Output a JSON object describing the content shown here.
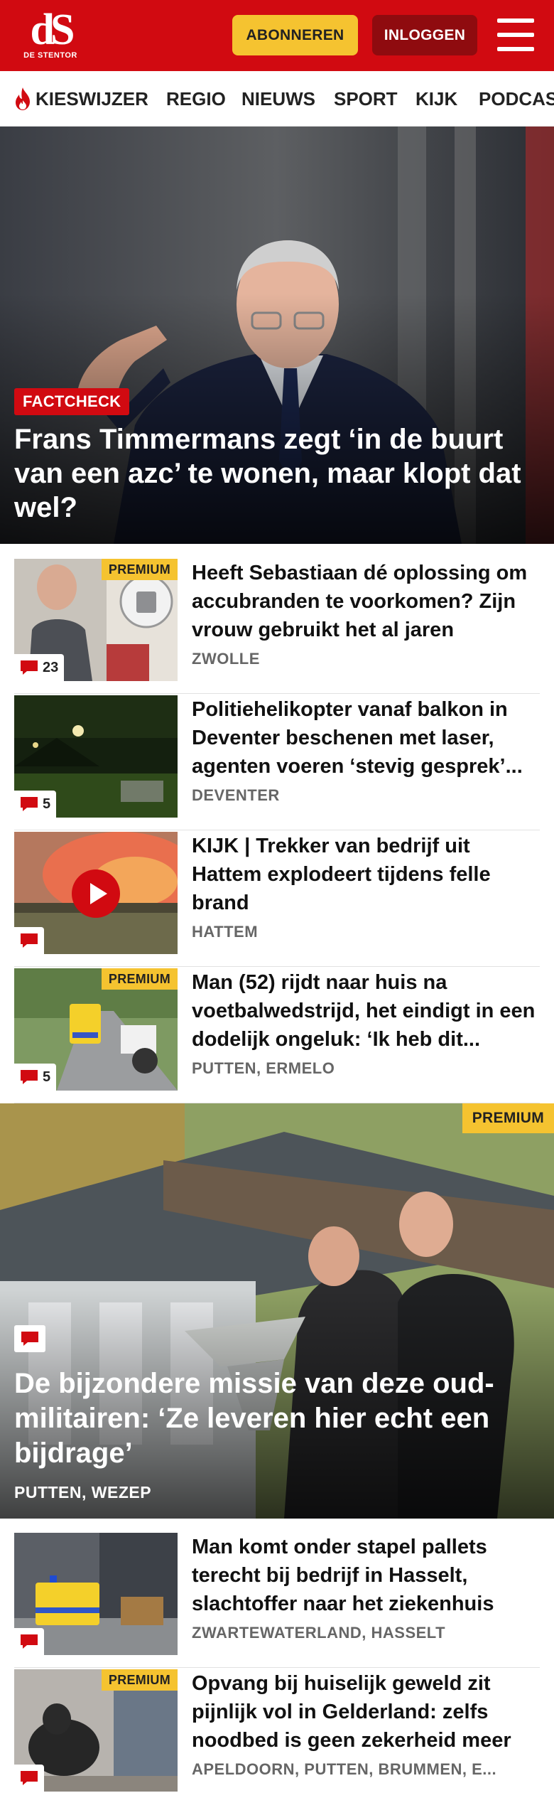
{
  "header": {
    "logo_text": "dS",
    "logo_sub": "DE STENTOR",
    "subscribe_label": "ABONNEREN",
    "login_label": "INLOGGEN",
    "menu_icon": "hamburger-menu-icon",
    "brand_color": "#d10a11"
  },
  "nav": {
    "items": [
      {
        "label": "KIESWIJZER",
        "icon": "flame-icon"
      },
      {
        "label": "REGIO"
      },
      {
        "label": "NIEUWS"
      },
      {
        "label": "SPORT"
      },
      {
        "label": "KIJK"
      },
      {
        "label": "PODCAS"
      }
    ]
  },
  "hero": {
    "label": "FACTCHECK",
    "title": "Frans Timmermans zegt ‘in de buurt van een azc’ te wonen, maar klopt dat wel?"
  },
  "articles": [
    {
      "title": "Heeft Sebastiaan dé oplossing om accubranden te voorkomen? Zijn vrouw gebruikt het al jaren",
      "location": "ZWOLLE",
      "premium": "PREMIUM",
      "comments": "23"
    },
    {
      "title": "Politiehelikopter vanaf balkon in Deventer beschenen met laser, agenten voeren ‘stevig gesprek’...",
      "location": "DEVENTER",
      "comments": "5"
    },
    {
      "title": "KIJK | Trekker van bedrijf uit Hattem explodeert tijdens felle brand",
      "location": "HATTEM",
      "video": "play-icon"
    },
    {
      "title": "Man (52) rijdt naar huis na voetbalwedstrijd, het eindigt in een dodelijk ongeluk: ‘Ik heb dit...",
      "location": "PUTTEN, ERMELO",
      "premium": "PREMIUM",
      "comments": "5"
    }
  ],
  "feature": {
    "premium": "PREMIUM",
    "title": "De bijzondere missie van deze oud-militairen: ‘Ze leveren hier echt een bijdrage’",
    "location": "PUTTEN, WEZEP"
  },
  "articles_more": [
    {
      "title": "Man komt onder stapel pallets terecht bij bedrijf in Hasselt, slachtoffer naar het ziekenhuis",
      "location": "ZWARTEWATERLAND, HASSELT"
    },
    {
      "title": "Opvang bij huiselijk geweld zit pijnlijk vol in Gelderland: zelfs noodbed is geen zekerheid meer",
      "location": "APELDOORN, PUTTEN, BRUMMEN, E...",
      "premium": "PREMIUM"
    }
  ]
}
